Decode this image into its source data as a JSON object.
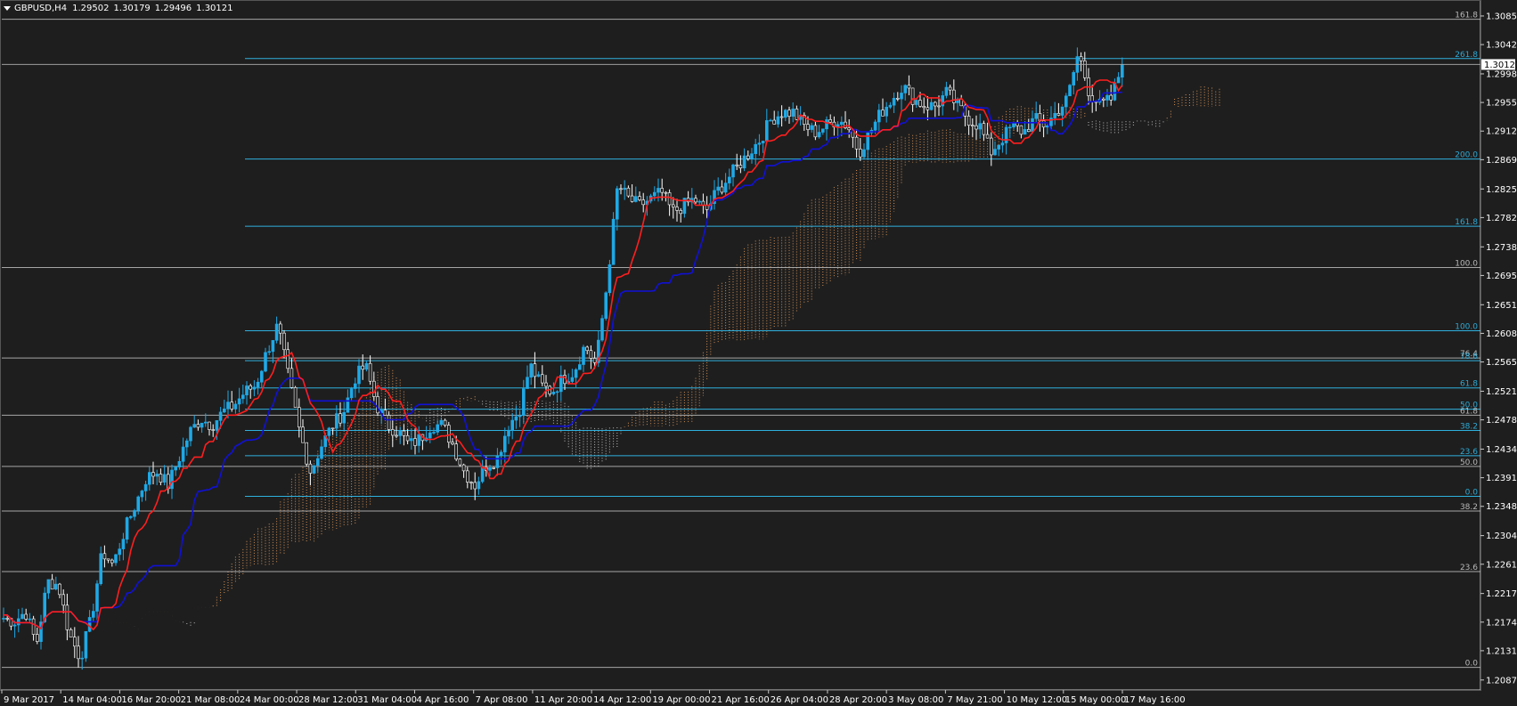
{
  "header": {
    "symbol": "GBPUSD,H4",
    "open": "1.29502",
    "high": "1.30179",
    "low": "1.29496",
    "close": "1.30121"
  },
  "colors": {
    "background": "#1e1e1e",
    "axis": "#c8c8c8",
    "text": "#ffffff",
    "candle": "#1fa9e6",
    "tenkan": "#ff1e1e",
    "kijun": "#1010d8",
    "cloud_bear": "#d8d8d8",
    "cloud_bull": "#f4a460",
    "fib": "#2fb8e8",
    "level": "#c8c8c8"
  },
  "chart_data": {
    "type": "candlestick",
    "ylim": [
      1.2072,
      1.3105
    ],
    "price_ticks": [
      "1.30850",
      "1.30420",
      "1.29980",
      "1.29550",
      "1.29120",
      "1.28690",
      "1.28250",
      "1.27820",
      "1.27380",
      "1.26950",
      "1.26510",
      "1.26080",
      "1.25650",
      "1.25210",
      "1.24780",
      "1.24340",
      "1.23910",
      "1.23480",
      "1.23040",
      "1.22610",
      "1.22170",
      "1.21740",
      "1.21310",
      "1.20870"
    ],
    "current_price": "1.30121",
    "time_labels": [
      "9 Mar 2017",
      "14 Mar 04:00",
      "16 Mar 20:00",
      "21 Mar 08:00",
      "24 Mar 00:00",
      "28 Mar 12:00",
      "31 Mar 04:00",
      "4 Apr 16:00",
      "7 Apr 08:00",
      "11 Apr 20:00",
      "14 Apr 12:00",
      "19 Apr 00:00",
      "21 Apr 16:00",
      "26 Apr 04:00",
      "28 Apr 20:00",
      "3 May 08:00",
      "7 May 21:00",
      "10 May 12:00",
      "15 May 00:00",
      "17 May 16:00"
    ],
    "close_path": [
      1.218,
      1.2175,
      1.219,
      1.214,
      1.2235,
      1.223,
      1.2155,
      1.212,
      1.218,
      1.228,
      1.226,
      1.231,
      1.235,
      1.239,
      1.24,
      1.238,
      1.242,
      1.246,
      1.248,
      1.247,
      1.249,
      1.25,
      1.252,
      1.253,
      1.258,
      1.262,
      1.254,
      1.246,
      1.24,
      1.244,
      1.247,
      1.249,
      1.254,
      1.256,
      1.25,
      1.247,
      1.246,
      1.244,
      1.245,
      1.247,
      1.247,
      1.244,
      1.24,
      1.238,
      1.241,
      1.242,
      1.247,
      1.249,
      1.256,
      1.253,
      1.252,
      1.254,
      1.255,
      1.259,
      1.256,
      1.268,
      1.283,
      1.281,
      1.28,
      1.281,
      1.282,
      1.279,
      1.28,
      1.281,
      1.279,
      1.282,
      1.284,
      1.286,
      1.288,
      1.29,
      1.293,
      1.294,
      1.294,
      1.292,
      1.291,
      1.292,
      1.293,
      1.292,
      1.288,
      1.291,
      1.294,
      1.296,
      1.298,
      1.296,
      1.295,
      1.295,
      1.297,
      1.295,
      1.293,
      1.292,
      1.288,
      1.29,
      1.292,
      1.291,
      1.293,
      1.292,
      1.294,
      1.296,
      1.303,
      1.297,
      1.295,
      1.296,
      1.3012
    ],
    "fib_levels": [
      {
        "label": "161.8",
        "price": 1.308,
        "style": "level"
      },
      {
        "label": "261.8",
        "price": 1.3021,
        "style": "fib"
      },
      {
        "label": "200.0",
        "price": 1.287,
        "style": "fib"
      },
      {
        "label": "161.8",
        "price": 1.2769,
        "style": "fib"
      },
      {
        "label": "100.0",
        "price": 1.2707,
        "style": "level"
      },
      {
        "label": "100.0",
        "price": 1.2612,
        "style": "fib"
      },
      {
        "label": "76.4",
        "price": 1.2571,
        "style": "level"
      },
      {
        "label": "78.6",
        "price": 1.2567,
        "style": "fib"
      },
      {
        "label": "61.8",
        "price": 1.2526,
        "style": "fib"
      },
      {
        "label": "50.0",
        "price": 1.2494,
        "style": "fib"
      },
      {
        "label": "61.8",
        "price": 1.2485,
        "style": "level"
      },
      {
        "label": "38.2",
        "price": 1.2462,
        "style": "fib"
      },
      {
        "label": "23.6",
        "price": 1.2424,
        "style": "fib"
      },
      {
        "label": "50.0",
        "price": 1.2408,
        "style": "level"
      },
      {
        "label": "0.0",
        "price": 1.2363,
        "style": "fib"
      },
      {
        "label": "38.2",
        "price": 1.2341,
        "style": "level"
      },
      {
        "label": "23.6",
        "price": 1.225,
        "style": "level"
      },
      {
        "label": "0.0",
        "price": 1.2106,
        "style": "level"
      }
    ]
  }
}
